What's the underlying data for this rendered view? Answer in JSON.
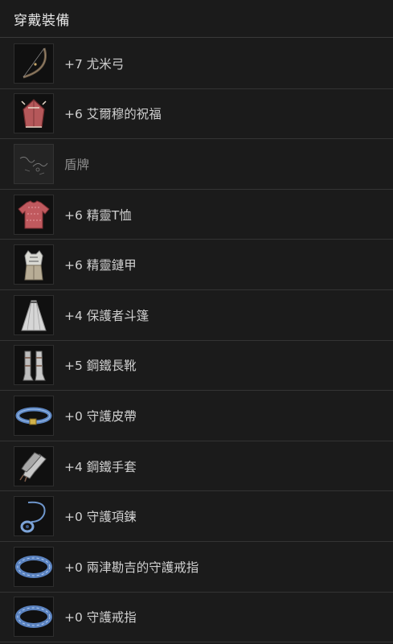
{
  "header": {
    "title": "穿戴裝備"
  },
  "equipment": [
    {
      "label": "+7 尤米弓",
      "icon": "bow-icon"
    },
    {
      "label": "+6 艾爾穆的祝福",
      "icon": "shirt-blessing-icon"
    },
    {
      "label": "盾牌",
      "icon": "empty-shield-slot-icon",
      "empty": true
    },
    {
      "label": "+6 精靈T恤",
      "icon": "red-tshirt-icon"
    },
    {
      "label": "+6 精靈鏈甲",
      "icon": "chainmail-armor-icon"
    },
    {
      "label": "+4 保護者斗篷",
      "icon": "white-cloak-icon"
    },
    {
      "label": "+5 鋼鐵長靴",
      "icon": "steel-boots-icon"
    },
    {
      "label": "+0 守護皮帶",
      "icon": "blue-belt-icon"
    },
    {
      "label": "+4 鋼鐵手套",
      "icon": "steel-gloves-icon"
    },
    {
      "label": "+0 守護項鍊",
      "icon": "blue-necklace-icon"
    },
    {
      "label": "+0 兩津勘吉的守護戒指",
      "icon": "blue-ring-icon"
    },
    {
      "label": "+0 守護戒指",
      "icon": "blue-ring-icon"
    }
  ]
}
